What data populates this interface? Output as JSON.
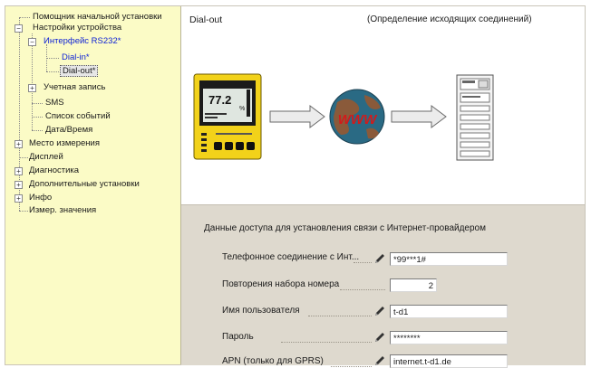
{
  "tree": {
    "items": [
      {
        "label": "Помощник начальной установки"
      },
      {
        "label": "Настройки устройства"
      },
      {
        "label": "Интерфейс RS232*"
      },
      {
        "label": "Dial-in*"
      },
      {
        "label": "Dial-out*"
      },
      {
        "label": "Учетная запись"
      },
      {
        "label": "SMS"
      },
      {
        "label": "Список событий"
      },
      {
        "label": "Дата/Время"
      },
      {
        "label": "Место измерения"
      },
      {
        "label": "Дисплей"
      },
      {
        "label": "Диагностика"
      },
      {
        "label": "Дополнительные установки"
      },
      {
        "label": "Инфо"
      },
      {
        "label": "Измер. значения"
      }
    ],
    "expand_minus": "−",
    "expand_plus": "+"
  },
  "header": {
    "title": "Dial-out",
    "subtitle": "(Определение исходящих соединений)"
  },
  "diagram": {
    "device_icon": "measuring-device-icon",
    "globe_icon": "www-globe-icon",
    "server_icon": "server-icon",
    "arrow_icon": "arrow-right-icon",
    "device_reading": "77.2",
    "device_unit": "%",
    "globe_text": "WWW"
  },
  "form": {
    "section_title": "Данные доступа для установления связи с Интернет-провайдером",
    "rows": [
      {
        "label": "Телефонное соединение с Инт...",
        "value": "*99***1#"
      },
      {
        "label": "Повторения набора номера",
        "value": "2"
      },
      {
        "label": "Имя пользователя",
        "value": "t-d1"
      },
      {
        "label": "Пароль",
        "value": "********"
      },
      {
        "label": "APN (только для GPRS)",
        "value": "internet.t-d1.de"
      }
    ],
    "edit_icon": "pencil-icon"
  },
  "colors": {
    "tree_bg": "#fbfbc6",
    "form_bg": "#ded9ce",
    "selected_text": "#0b1fd6",
    "device_yellow": "#f2d21a"
  }
}
